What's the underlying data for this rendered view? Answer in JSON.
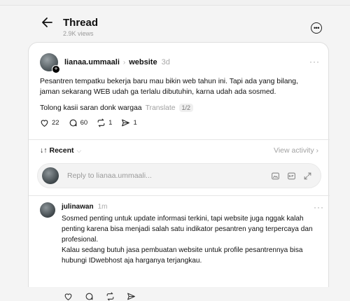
{
  "header": {
    "title": "Thread",
    "views": "2.9K views"
  },
  "post": {
    "username": "lianaa.ummaali",
    "topic": "website",
    "time": "3d",
    "text": "Pesantren tempatku bekerja baru mau bikin web tahun ini. Tapi ada yang bilang, jaman sekarang WEB udah ga terlalu dibutuhin, karna udah ada sosmed.",
    "text2": "Tolong kasii saran donk wargaa",
    "translate_label": "Translate",
    "pager": "1/2",
    "likes": "22",
    "replies": "60",
    "reposts": "1",
    "shares": "1"
  },
  "sort": {
    "label": "Recent",
    "view_activity": "View activity"
  },
  "reply_box": {
    "placeholder": "Reply to lianaa.ummaali..."
  },
  "reply": {
    "username": "julinawan",
    "time": "1m",
    "text_1": "Sosmed penting untuk update informasi terkini, tapi website juga nggak kalah penting karena bisa menjadi salah satu indikator pesantren yang terpercaya dan profesional.",
    "text_2": "Kalau sedang butuh jasa pembuatan website untuk profile pesantrennya bisa hubungi IDwebhost aja harganya terjangkau."
  }
}
